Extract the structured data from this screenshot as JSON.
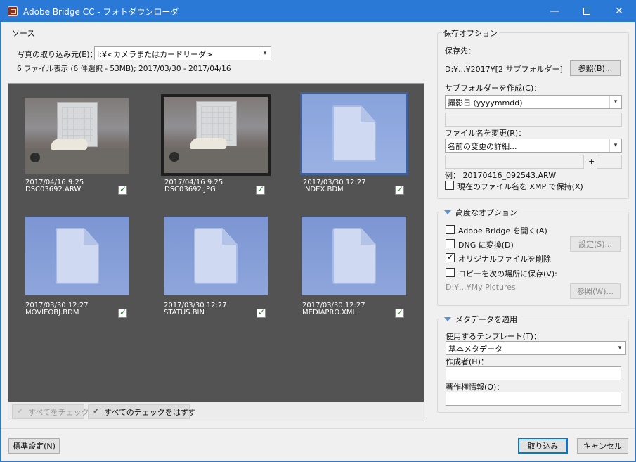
{
  "titlebar": {
    "title": "Adobe Bridge CC - フォトダウンローダ",
    "minimize_glyph": "—",
    "close_glyph": "✕"
  },
  "source": {
    "group_label": "ソース",
    "get_from_label": "写真の取り込み元(E)：",
    "get_from_value": "I:¥<カメラまたはカードリーダ>",
    "summary": "6 ファイル表示 (6 件選択 - 53MB); 2017/03/30 - 2017/04/16"
  },
  "thumbnails": [
    {
      "date": "2017/04/16 9:25",
      "name": "DSC03692.ARW",
      "kind": "photo",
      "checked": true
    },
    {
      "date": "2017/04/16 9:25",
      "name": "DSC03692.JPG",
      "kind": "photo",
      "checked": true
    },
    {
      "date": "2017/03/30 12:27",
      "name": "INDEX.BDM",
      "kind": "document",
      "checked": true
    },
    {
      "date": "2017/03/30 12:27",
      "name": "MOVIEOBJ.BDM",
      "kind": "document",
      "checked": true
    },
    {
      "date": "2017/03/30 12:27",
      "name": "STATUS.BIN",
      "kind": "document",
      "checked": true
    },
    {
      "date": "2017/03/30 12:27",
      "name": "MEDIAPRO.XML",
      "kind": "document",
      "checked": true
    }
  ],
  "viewer_buttons": {
    "check_all": "すべてをチェック",
    "uncheck_all": "すべてのチェックをはずす"
  },
  "save_options": {
    "group_label": "保存オプション",
    "location_label": "保存先：",
    "location_value": "D:¥...¥2017¥[2 サブフォルダー]",
    "browse_label": "参照(B)...",
    "subfolder_label": "サブフォルダーを作成(C)：",
    "subfolder_value": "撮影日 (yyyymmdd)",
    "rename_label": "ファイル名を変更(R)：",
    "rename_value": "名前の変更の詳細...",
    "plus": "+",
    "example": "例： 20170416_092543.ARW",
    "preserve_xmp_label": "現在のファイル名を XMP で保持(X)",
    "preserve_xmp_checked": false
  },
  "advanced": {
    "header": "高度なオプション",
    "open_bridge_label": "Adobe Bridge を開く(A)",
    "open_bridge_checked": false,
    "convert_dng_label": "DNG に変換(D)",
    "convert_dng_checked": false,
    "settings_label": "設定(S)...",
    "delete_originals_label": "オリジナルファイルを削除",
    "delete_originals_checked": true,
    "copy_to_label": "コピーを次の場所に保存(V):",
    "copy_to_checked": false,
    "copy_path": "D:¥...¥My Pictures",
    "browse2_label": "参照(W)..."
  },
  "metadata": {
    "header": "メタデータを適用",
    "template_label": "使用するテンプレート(T)：",
    "template_value": "基本メタデータ",
    "creator_label": "作成者(H)：",
    "copyright_label": "著作権情報(O)："
  },
  "footer": {
    "standard_label": "標準設定(N)",
    "get_media_label": "取り込み",
    "cancel_label": "キャンセル"
  },
  "colors": {
    "titlebar": "#2b79d7",
    "viewer_bg": "#535353",
    "doc_thumb": "#8fa6dc"
  }
}
